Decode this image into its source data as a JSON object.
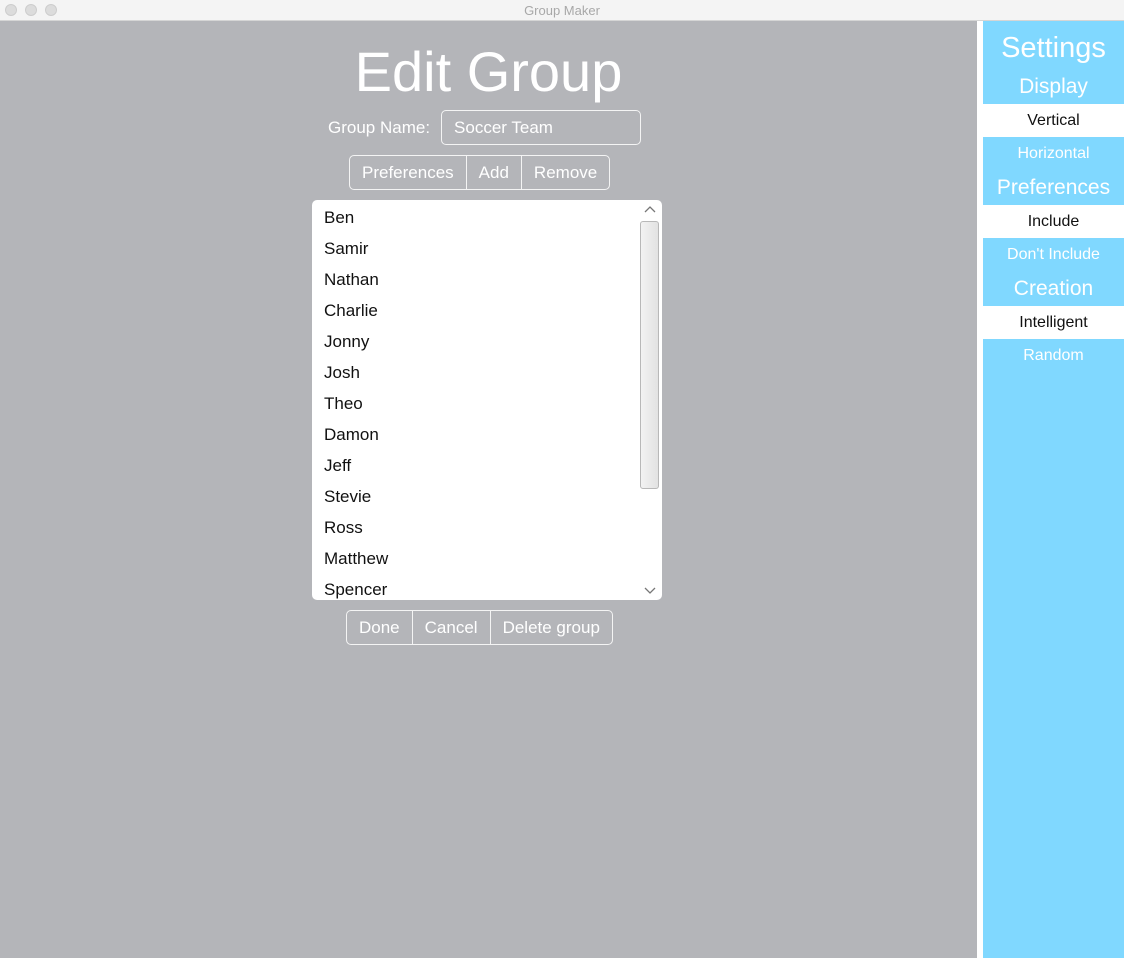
{
  "window": {
    "title": "Group Maker"
  },
  "main": {
    "page_title": "Edit Group",
    "group_name_label": "Group Name:",
    "group_name_value": "Soccer Team",
    "top_buttons": [
      "Preferences",
      "Add",
      "Remove"
    ],
    "members": [
      "Ben",
      "Samir",
      "Nathan",
      "Charlie",
      "Jonny",
      "Josh",
      "Theo",
      "Damon",
      "Jeff",
      "Stevie",
      "Ross",
      "Matthew",
      "Spencer"
    ],
    "bottom_buttons": [
      "Done",
      "Cancel",
      "Delete group"
    ],
    "scroll_up_icon": "⌃",
    "scroll_down_icon": "⌄"
  },
  "sidebar": {
    "title": "Settings",
    "sections": [
      {
        "header": "Display",
        "options": [
          {
            "label": "Vertical",
            "selected": true
          },
          {
            "label": "Horizontal",
            "selected": false
          }
        ]
      },
      {
        "header": "Preferences",
        "options": [
          {
            "label": "Include",
            "selected": true
          },
          {
            "label": "Don't Include",
            "selected": false
          }
        ]
      },
      {
        "header": "Creation",
        "options": [
          {
            "label": "Intelligent",
            "selected": true
          },
          {
            "label": "Random",
            "selected": false
          }
        ]
      }
    ]
  },
  "colors": {
    "background": "#b4b5b9",
    "sidebar": "#80d8ff",
    "selected_option": "#ffffff"
  }
}
